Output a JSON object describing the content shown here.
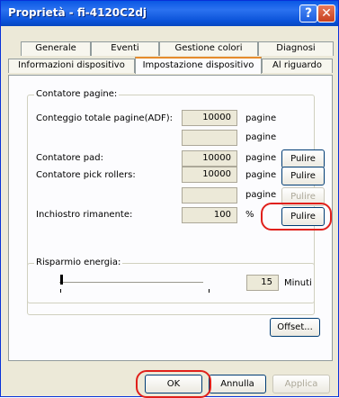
{
  "window": {
    "title": "Proprietà - fi-4120C2dj",
    "help_label": "?",
    "close_label": "✕",
    "colors": {
      "titlebar": "#0a58e4",
      "highlight": "#e0201b"
    }
  },
  "tabs_row1": [
    "Generale",
    "Eventi",
    "Gestione colori",
    "Diagnosi"
  ],
  "tabs_row2": [
    "Informazioni dispositivo",
    "Impostazione dispositivo",
    "Al riguardo"
  ],
  "active_tab": "Impostazione dispositivo",
  "page_counter": {
    "title": "Contatore pagine:",
    "rows": [
      {
        "label": "Conteggio totale pagine(ADF):",
        "value": "10000",
        "unit": "pagine"
      },
      {
        "label": "",
        "value": "",
        "unit": "pagine"
      },
      {
        "label": "Contatore pad:",
        "value": "10000",
        "unit": "pagine",
        "button": "Pulire"
      },
      {
        "label": "Contatore pick rollers:",
        "value": "10000",
        "unit": "pagine",
        "button": "Pulire"
      },
      {
        "label": "",
        "value": "",
        "unit": "pagine",
        "button": "Pulire",
        "button_disabled": true
      },
      {
        "label": "Inchiostro rimanente:",
        "value": "100",
        "unit": "%",
        "button": "Pulire"
      }
    ]
  },
  "energy": {
    "title": "Risparmio energia:",
    "value": "15",
    "unit": "Minuti",
    "slider_level": 0.0
  },
  "offset_button": "Offset...",
  "footer": {
    "ok": "OK",
    "cancel": "Annulla",
    "apply": "Applica"
  }
}
